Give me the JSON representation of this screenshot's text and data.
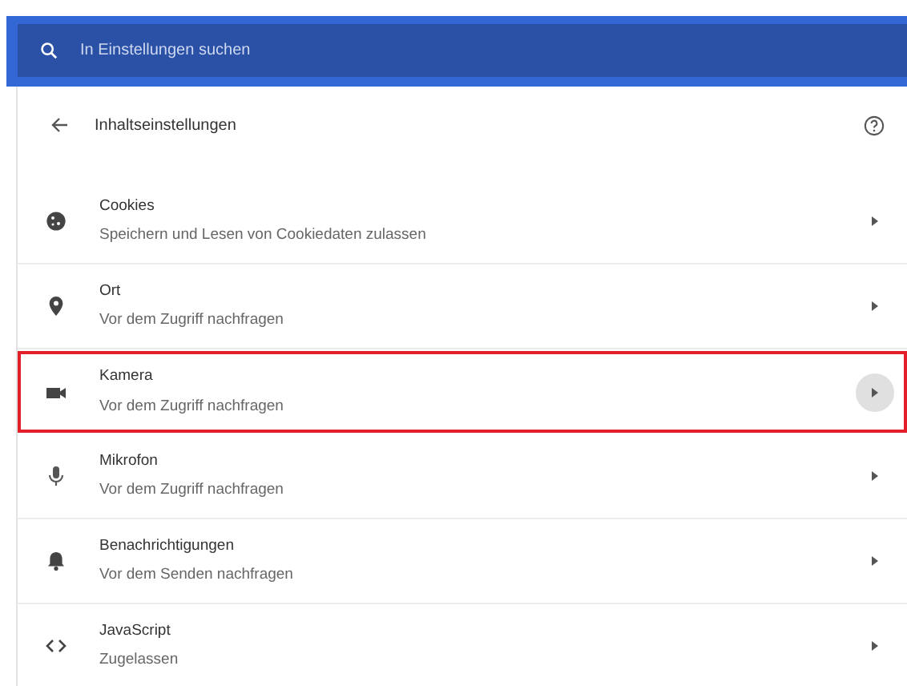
{
  "search": {
    "placeholder": "In Einstellungen suchen"
  },
  "header": {
    "title": "Inhaltseinstellungen"
  },
  "items": [
    {
      "kind": "cookie",
      "title": "Cookies",
      "subtitle": "Speichern und Lesen von Cookiedaten zulassen",
      "selected": false
    },
    {
      "kind": "location",
      "title": "Ort",
      "subtitle": "Vor dem Zugriff nachfragen",
      "selected": false
    },
    {
      "kind": "camera",
      "title": "Kamera",
      "subtitle": "Vor dem Zugriff nachfragen",
      "selected": true
    },
    {
      "kind": "microphone",
      "title": "Mikrofon",
      "subtitle": "Vor dem Zugriff nachfragen",
      "selected": false
    },
    {
      "kind": "bell",
      "title": "Benachrichtigungen",
      "subtitle": "Vor dem Senden nachfragen",
      "selected": false
    },
    {
      "kind": "code",
      "title": "JavaScript",
      "subtitle": "Zugelassen",
      "selected": false
    }
  ]
}
